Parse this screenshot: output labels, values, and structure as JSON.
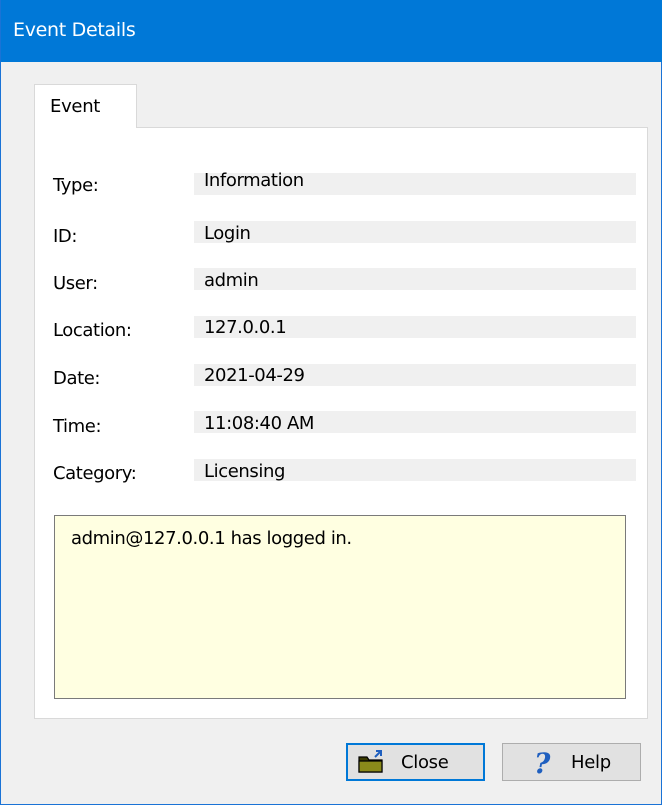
{
  "window": {
    "title": "Event Details"
  },
  "tabs": [
    {
      "label": "Event"
    }
  ],
  "fields": [
    {
      "label": "Type:",
      "value": "Information"
    },
    {
      "label": "ID:",
      "value": "Login"
    },
    {
      "label": "User:",
      "value": "admin"
    },
    {
      "label": "Location:",
      "value": "127.0.0.1"
    },
    {
      "label": "Date:",
      "value": "2021-04-29"
    },
    {
      "label": "Time:",
      "value": "11:08:40 AM"
    },
    {
      "label": "Category:",
      "value": "Licensing"
    }
  ],
  "message": "admin@127.0.0.1 has logged in.",
  "buttons": {
    "close_label": "Close",
    "help_label": "Help"
  },
  "icons": {
    "close": "folder-close-icon",
    "help": "question-mark-icon"
  },
  "colors": {
    "titlebar": "#0078d7",
    "message_bg": "#ffffe1",
    "help_icon": "#1f5fbf"
  }
}
